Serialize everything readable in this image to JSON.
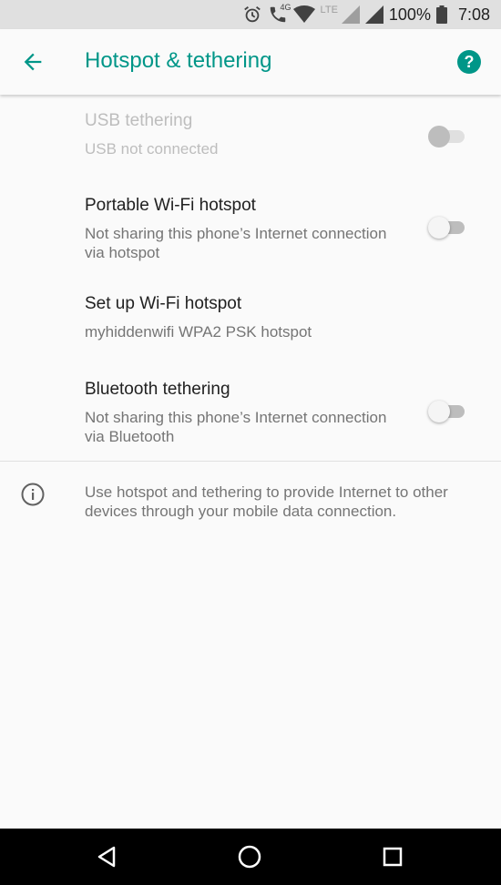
{
  "status_bar": {
    "network_type": "4G",
    "lte_label": "LTE",
    "battery": "100%",
    "time": "7:08"
  },
  "app_bar": {
    "title": "Hotspot & tethering",
    "back_icon": "arrow-back-icon",
    "help_icon": "help-icon",
    "help_glyph": "?"
  },
  "settings": [
    {
      "title": "USB tethering",
      "summary": "USB not connected",
      "has_switch": true,
      "switch_on": false,
      "enabled": false
    },
    {
      "title": "Portable Wi-Fi hotspot",
      "summary": "Not sharing this phone’s Internet connection via hotspot",
      "has_switch": true,
      "switch_on": false,
      "enabled": true
    },
    {
      "title": "Set up Wi-Fi hotspot",
      "summary": "myhiddenwifi WPA2 PSK hotspot",
      "has_switch": false,
      "enabled": true
    },
    {
      "title": "Bluetooth tethering",
      "summary": "Not sharing this phone’s Internet connection via Bluetooth",
      "has_switch": true,
      "switch_on": false,
      "enabled": true
    }
  ],
  "footer": {
    "icon": "info-icon",
    "text": "Use hotspot and tethering to provide Internet to other devices through your mobile data connection."
  },
  "nav_bar": {
    "back": "nav-back-icon",
    "home": "nav-home-icon",
    "recents": "nav-recents-icon"
  },
  "colors": {
    "accent": "#009688",
    "background": "#fafafa",
    "status_bar": "#e0e0e0",
    "nav_bar": "#000000"
  }
}
